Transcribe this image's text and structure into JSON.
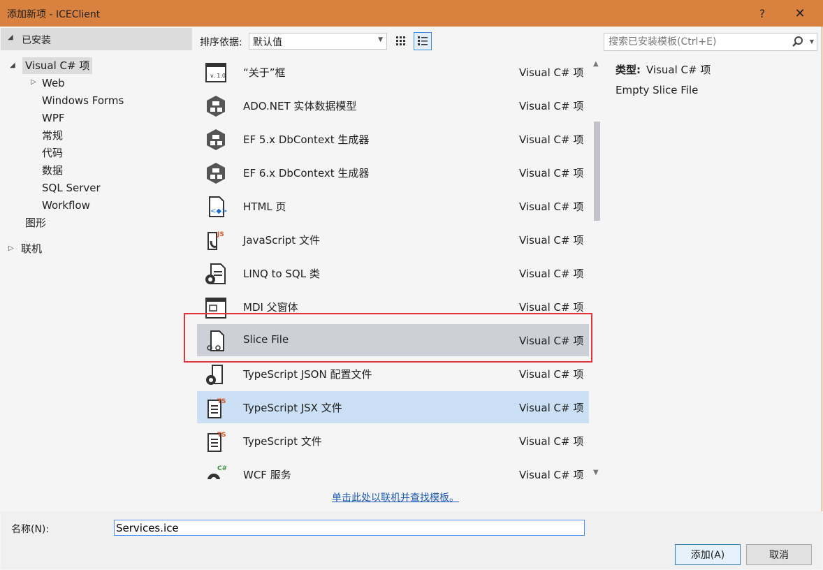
{
  "window": {
    "title": "添加新项 - ICEClient",
    "help": "?",
    "close": "✕"
  },
  "tree": {
    "installed": "已安装",
    "selected": "Visual C# 项",
    "children": [
      "Web",
      "Windows Forms",
      "WPF",
      "常规",
      "代码",
      "数据",
      "SQL Server",
      "Workflow"
    ],
    "graphics": "图形",
    "online": "联机"
  },
  "toolbar": {
    "sort_label": "排序依据:",
    "sort_value": "默认值",
    "search_placeholder": "搜索已安装模板(Ctrl+E)"
  },
  "items": [
    {
      "name": "“关于”框",
      "category": "Visual C# 项",
      "icon": "about-box-icon"
    },
    {
      "name": "ADO.NET 实体数据模型",
      "category": "Visual C# 项",
      "icon": "entity-model-icon"
    },
    {
      "name": "EF 5.x DbContext 生成器",
      "category": "Visual C# 项",
      "icon": "entity-model-icon"
    },
    {
      "name": "EF 6.x DbContext 生成器",
      "category": "Visual C# 项",
      "icon": "entity-model-icon"
    },
    {
      "name": "HTML 页",
      "category": "Visual C# 项",
      "icon": "html-page-icon"
    },
    {
      "name": "JavaScript 文件",
      "category": "Visual C# 项",
      "icon": "javascript-file-icon"
    },
    {
      "name": "LINQ to SQL 类",
      "category": "Visual C# 项",
      "icon": "linq-to-sql-icon"
    },
    {
      "name": "MDI 父窗体",
      "category": "Visual C# 项",
      "icon": "mdi-form-icon"
    },
    {
      "name": "Slice File",
      "category": "Visual C# 项",
      "icon": "slice-file-icon"
    },
    {
      "name": "TypeScript JSON 配置文件",
      "category": "Visual C# 项",
      "icon": "json-config-icon"
    },
    {
      "name": "TypeScript JSX 文件",
      "category": "Visual C# 项",
      "icon": "typescript-file-icon"
    },
    {
      "name": "TypeScript 文件",
      "category": "Visual C# 项",
      "icon": "typescript-file-icon"
    },
    {
      "name": "WCF 服务",
      "category": "Visual C# 项",
      "icon": "wcf-service-icon"
    }
  ],
  "details": {
    "type_label": "类型:",
    "type_value": "Visual C# 项",
    "description": "Empty Slice File"
  },
  "online_link": "单击此处以联机并查找模板。",
  "name_field": {
    "label": "名称(N):",
    "value": "Services.ice"
  },
  "buttons": {
    "add": "添加(A)",
    "cancel": "取消"
  },
  "colors": {
    "titlebar": "#d9823f",
    "selection": "#cdd0d7",
    "hover": "#cbe0f5",
    "highlight_box": "#e5333b",
    "link": "#1c5ab4"
  }
}
